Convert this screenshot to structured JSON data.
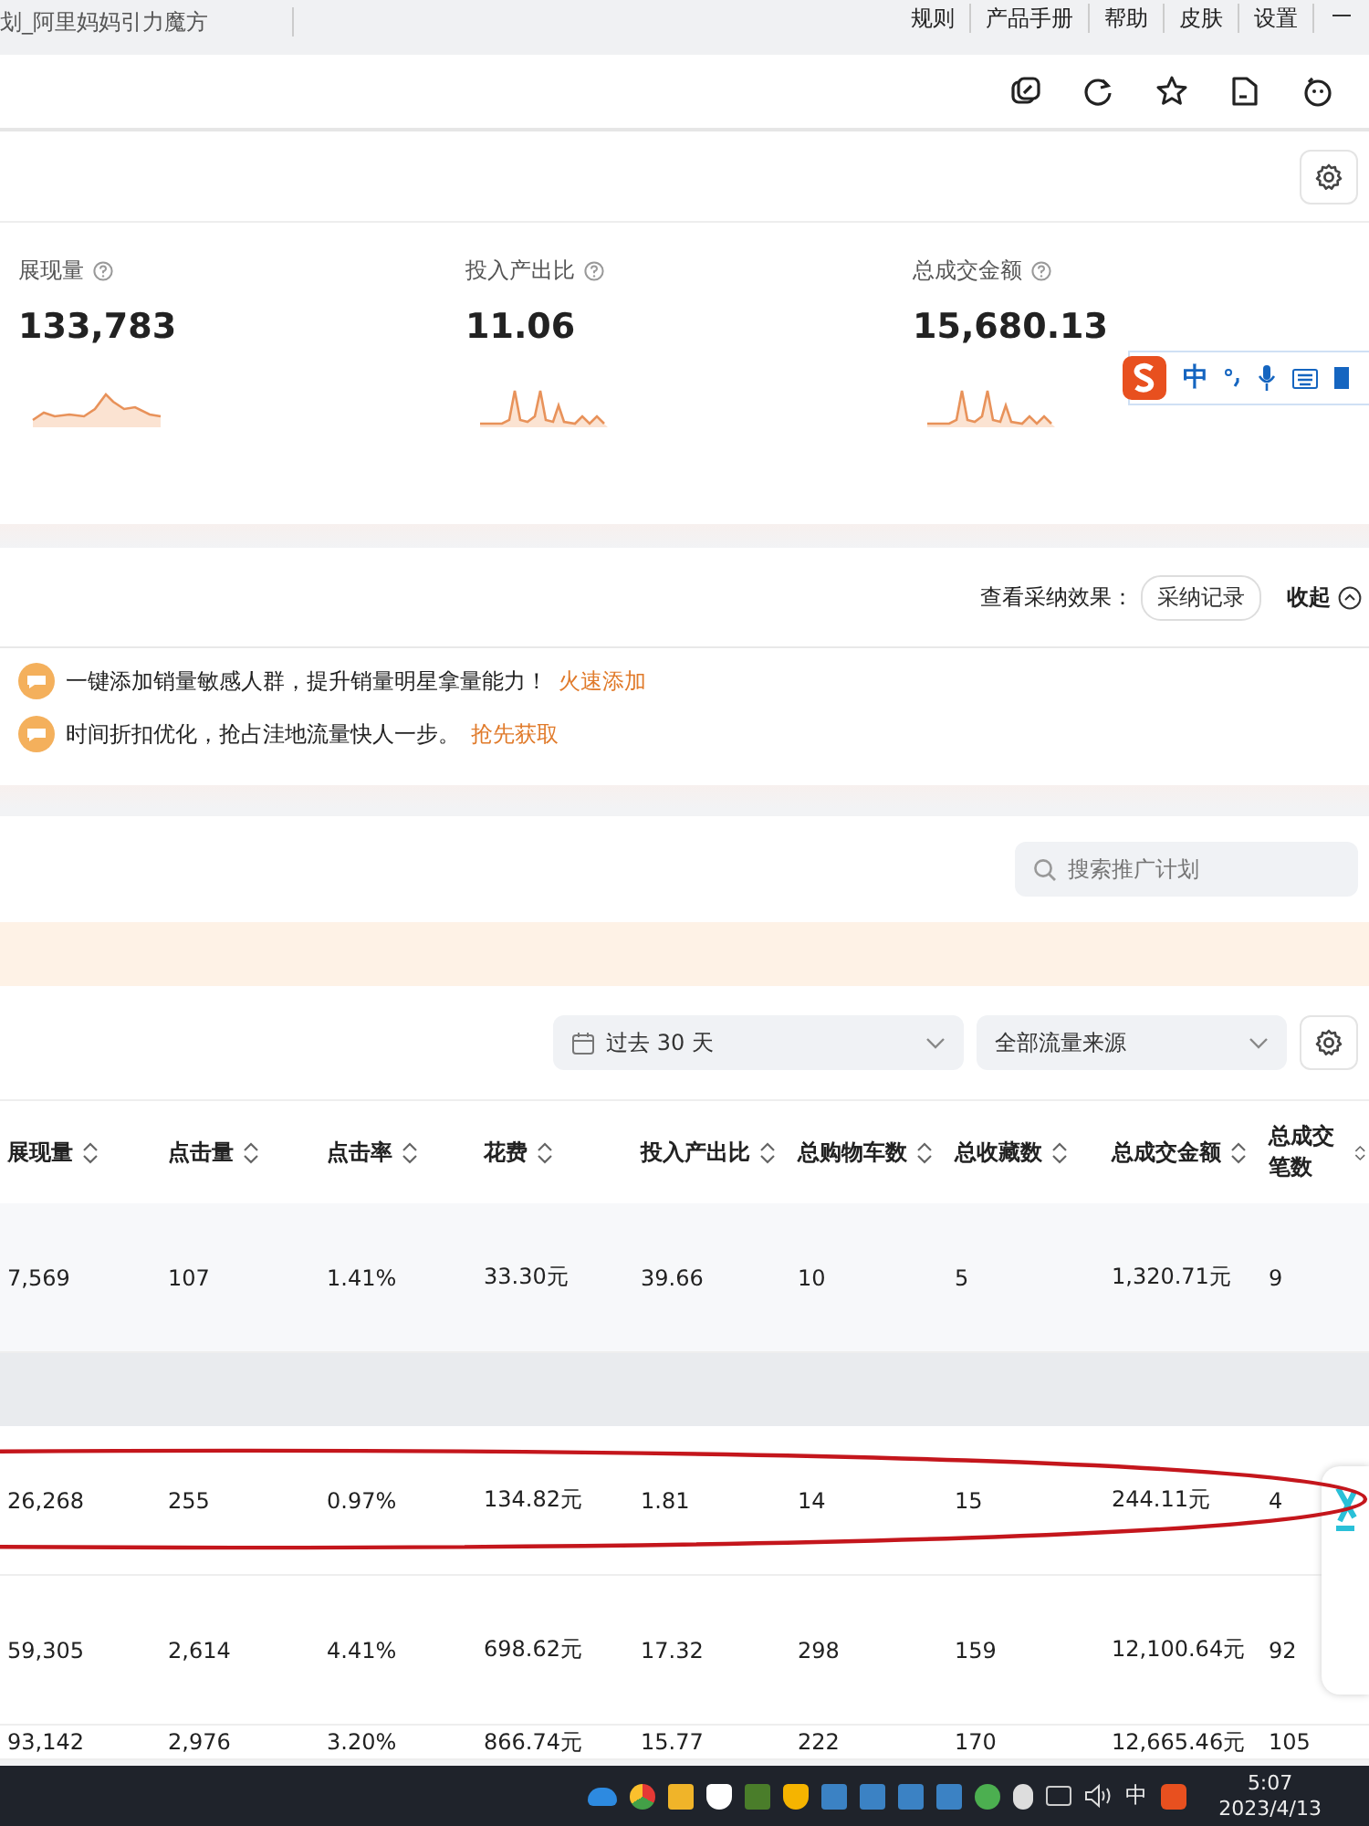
{
  "header": {
    "title": "划_阿里妈妈引力魔方",
    "links": [
      "规则",
      "产品手册",
      "帮助",
      "皮肤",
      "设置"
    ]
  },
  "metrics": [
    {
      "label": "展现量",
      "value": "133,783"
    },
    {
      "label": "投入产出比",
      "value": "11.06"
    },
    {
      "label": "总成交金额",
      "value": "15,680.13"
    }
  ],
  "ime_toolbar": {
    "mode": "中"
  },
  "suggestions": {
    "effect_label": "查看采纳效果：",
    "record_button": "采纳记录",
    "collapse": "收起",
    "items": [
      {
        "text": "一键添加销量敏感人群，提升销量明星拿量能力！",
        "action": "火速添加"
      },
      {
        "text": "时间折扣优化，抢占洼地流量快人一步。",
        "action": "抢先获取"
      }
    ]
  },
  "search": {
    "placeholder": "搜索推广计划"
  },
  "filters": {
    "date_range": "过去 30 天",
    "traffic_source": "全部流量来源"
  },
  "table": {
    "columns": [
      "展现量",
      "点击量",
      "点击率",
      "花费",
      "投入产出比",
      "总购物车数",
      "总收藏数",
      "总成交金额",
      "总成交笔数"
    ],
    "rows": [
      {
        "kind": "shaded",
        "highlighted": false,
        "cells": [
          "7,569",
          "107",
          "1.41%",
          "33.30元",
          "39.66",
          "10",
          "5",
          "1,320.71元",
          "9"
        ]
      },
      {
        "kind": "group"
      },
      {
        "kind": "plain",
        "highlighted": true,
        "cells": [
          "26,268",
          "255",
          "0.97%",
          "134.82元",
          "1.81",
          "14",
          "15",
          "244.11元",
          "4"
        ]
      },
      {
        "kind": "plain",
        "highlighted": false,
        "cells": [
          "59,305",
          "2,614",
          "4.41%",
          "698.62元",
          "17.32",
          "298",
          "159",
          "12,100.64元",
          "92"
        ]
      },
      {
        "kind": "plain",
        "highlighted": false,
        "cells": [
          "93,142",
          "2,976",
          "3.20%",
          "866.74元",
          "15.77",
          "222",
          "170",
          "12,665.46元",
          "105"
        ]
      }
    ]
  },
  "taskbar": {
    "input_mode": "中",
    "time": "5:07",
    "date": "2023/4/13"
  }
}
